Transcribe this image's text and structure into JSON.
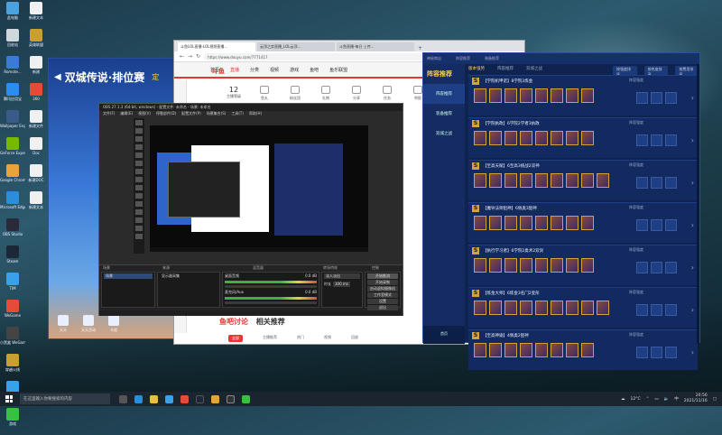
{
  "desktop": {
    "left_icons": [
      {
        "label": "此电脑",
        "color": "#4aa3df"
      },
      {
        "label": "回收站",
        "color": "#cfd8dc"
      },
      {
        "label": "Romote...",
        "color": "#3a7bd5"
      },
      {
        "label": "腾讯应用宝",
        "color": "#2d8cf0"
      },
      {
        "label": "Wallpaper Engine",
        "color": "#3a5a8a"
      },
      {
        "label": "GeForce Experience",
        "color": "#76b900"
      },
      {
        "label": "Google Chrome",
        "color": "#e8a33a"
      },
      {
        "label": "Microsoft Edge",
        "color": "#2a8fd8"
      },
      {
        "label": "OBS Studio",
        "color": "#2a2a3a"
      },
      {
        "label": "Steam",
        "color": "#1b2838"
      },
      {
        "label": "TIM",
        "color": "#3aa0e8"
      },
      {
        "label": "WeGame",
        "color": "#e84a3a"
      },
      {
        "label": "小黑盒 WeGame",
        "color": "#444"
      },
      {
        "label": "穿越火线",
        "color": "#c8a030"
      },
      {
        "label": "腾讯 QQ",
        "color": "#3aa0e8"
      },
      {
        "label": "游戏",
        "color": "#3ac040"
      }
    ],
    "right_icons": [
      {
        "label": "新建文本",
        "color": "#f0f0f0"
      },
      {
        "label": "英雄联盟",
        "color": "#c8a030"
      },
      {
        "label": "新建",
        "color": "#f0f0f0"
      },
      {
        "label": "360",
        "color": "#e84a3a"
      },
      {
        "label": "新建文件",
        "color": "#f0f0f0"
      },
      {
        "label": "Doc",
        "color": "#f0f0f0"
      },
      {
        "label": "新建DOC",
        "color": "#f0f0f0"
      },
      {
        "label": "新建文本",
        "color": "#f0f0f0"
      }
    ]
  },
  "game_window": {
    "title": "双城传说·排位赛",
    "badge": "定",
    "footer": [
      "天天",
      "天天活动",
      "卡组"
    ]
  },
  "browser": {
    "tabs": [
      "斗鱼LOL直播-LOL视频直播...",
      "云顶之弈直播_LOL云顶...",
      "斗鱼直播-每日·上传..."
    ],
    "address": "https://www.douyu.com/7771417",
    "site_logo": "斗鱼",
    "nav": [
      "首页",
      "直播",
      "分类",
      "视频",
      "游戏",
      "鱼吧",
      "鱼乐联盟"
    ],
    "nav_active": "直播",
    "tools": [
      {
        "label": "12",
        "sub": "主播等级"
      },
      {
        "label": "",
        "sub": "鱼丸"
      },
      {
        "label": "",
        "sub": "粉丝团"
      },
      {
        "label": "",
        "sub": "礼物"
      },
      {
        "label": "",
        "sub": "分享"
      },
      {
        "label": "",
        "sub": "任务"
      },
      {
        "label": "",
        "sub": "举报"
      },
      {
        "label": "",
        "sub": "更多"
      },
      {
        "label": "",
        "sub": "客户端"
      }
    ],
    "related_title_a": "鱼吧讨论",
    "related_title_b": "相关推荐",
    "related_tabs": [
      "全部",
      "主播推荐",
      "热门",
      "视频",
      "回放"
    ]
  },
  "obs": {
    "title": "OBS 27.1.3 (64-bit, windows) - 配置文件: 未命名 - 场景: 未命名",
    "menu": [
      "文件(F)",
      "编辑(E)",
      "视图(V)",
      "停靠部件(D)",
      "配置文件(P)",
      "场景集合(S)",
      "工具(T)",
      "帮助(H)"
    ],
    "docks": [
      "场景",
      "来源",
      "混音器",
      "转场特效",
      "控制"
    ],
    "scene_item": "场景",
    "source_item": "显示器采集",
    "mixer": [
      {
        "label": "桌面音频",
        "value": "0.0 dB"
      },
      {
        "label": "麦克风/Aux",
        "value": "0.0 dB"
      }
    ],
    "transition": {
      "type": "淡入淡出",
      "duration_label": "时长",
      "duration": "300 ms"
    },
    "controls": [
      "开始推流",
      "开始录制",
      "启动虚拟摄像机",
      "工作室模式",
      "设置",
      "退出"
    ]
  },
  "app": {
    "brand": "阵容推荐",
    "top_tabs": [
      "神秘商店",
      "阵容推荐",
      "装备推荐"
    ],
    "side_items": [
      "阵容推荐",
      "装备推荐",
      "双城之战"
    ],
    "side_active": "阵容推荐",
    "foot": "首页",
    "tabs": [
      "版本强势",
      "阵容推荐",
      "双城之战"
    ],
    "sort": [
      "按强度排序",
      "按热度排序",
      "按费用排序"
    ],
    "comps": [
      {
        "tier": "S",
        "name": "【学院机甲诺】8学院3炼金",
        "extra": "阵容强度",
        "champs": 8,
        "items": 3
      },
      {
        "tier": "S",
        "name": "【学院执政】6学院2学者3执政",
        "extra": "阵容强度",
        "champs": 8,
        "items": 3
      },
      {
        "tier": "S",
        "name": "【至高天赋】6至高3挑战2双神",
        "extra": "阵容强度",
        "champs": 9,
        "items": 3
      },
      {
        "tier": "S",
        "name": "【魔导法师狙神】6佩奥3狙神",
        "extra": "阵容强度",
        "champs": 8,
        "items": 3
      },
      {
        "tier": "S",
        "name": "【执行学习者】6学院2奥术2双剑",
        "extra": "阵容强度",
        "champs": 8,
        "items": 3
      },
      {
        "tier": "S",
        "name": "【炼金大师】6炼金3名门2变形",
        "extra": "阵容强度",
        "champs": 9,
        "items": 3
      },
      {
        "tier": "S",
        "name": "【至高神谕】4佩奥2狙神",
        "extra": "阵容强度",
        "champs": 8,
        "items": 3
      }
    ]
  },
  "taskbar": {
    "search_placeholder": "在这里输入你要搜索的内容",
    "temperature": "12°C",
    "lang": "中",
    "time": "20:56",
    "date": "2021/11/16"
  }
}
